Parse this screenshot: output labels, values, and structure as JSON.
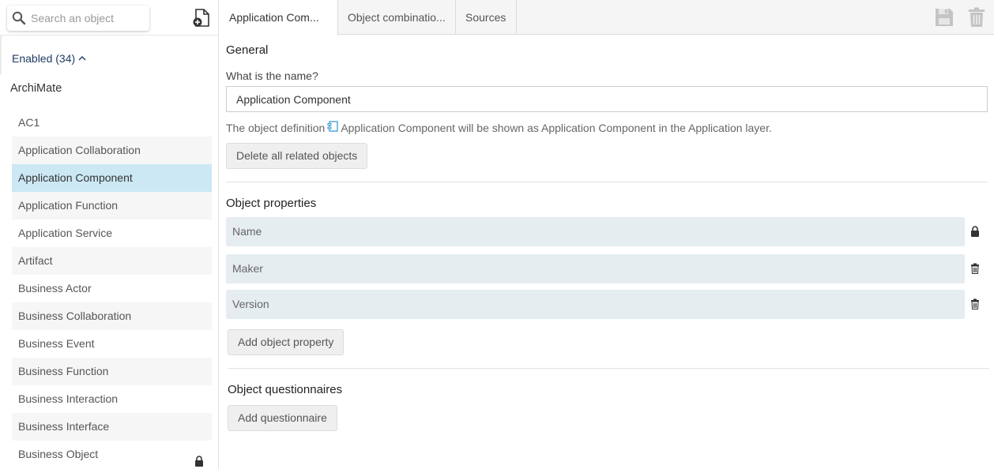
{
  "sidebar": {
    "search_placeholder": "Search an object",
    "enabled_label": "Enabled (34)",
    "group_title": "ArchiMate",
    "items": [
      {
        "label": "AC1",
        "locked": false
      },
      {
        "label": "Application Collaboration",
        "locked": false
      },
      {
        "label": "Application Component",
        "locked": false,
        "selected": true
      },
      {
        "label": "Application Function",
        "locked": false
      },
      {
        "label": "Application Service",
        "locked": false
      },
      {
        "label": "Artifact",
        "locked": false
      },
      {
        "label": "Business Actor",
        "locked": false
      },
      {
        "label": "Business Collaboration",
        "locked": false
      },
      {
        "label": "Business Event",
        "locked": false
      },
      {
        "label": "Business Function",
        "locked": false
      },
      {
        "label": "Business Interaction",
        "locked": false
      },
      {
        "label": "Business Interface",
        "locked": false
      },
      {
        "label": "Business Object",
        "locked": true
      }
    ]
  },
  "tabs": [
    {
      "label": "Application Com...",
      "active": true
    },
    {
      "label": "Object combinatio...",
      "active": false
    },
    {
      "label": "Sources",
      "active": false
    }
  ],
  "toolbar": {
    "save_icon": "save-icon",
    "delete_icon": "trash-icon"
  },
  "general": {
    "title": "General",
    "name_question": "What is the name?",
    "name_value": "Application Component",
    "definition_prefix": "The object definition",
    "definition_suffix": "Application Component will be shown as Application Component in the Application layer.",
    "delete_related_label": "Delete all related objects"
  },
  "properties": {
    "title": "Object properties",
    "items": [
      {
        "label": "Name",
        "icon": "lock-icon"
      },
      {
        "label": "Maker",
        "icon": "trash-icon"
      },
      {
        "label": "Version",
        "icon": "trash-icon"
      }
    ],
    "add_label": "Add object property"
  },
  "questionnaires": {
    "title": "Object questionnaires",
    "add_label": "Add questionnaire"
  },
  "colors": {
    "selected_bg": "#cce8f4",
    "property_bg": "#e6edf0",
    "accent_icon": "#3a9bd5"
  }
}
